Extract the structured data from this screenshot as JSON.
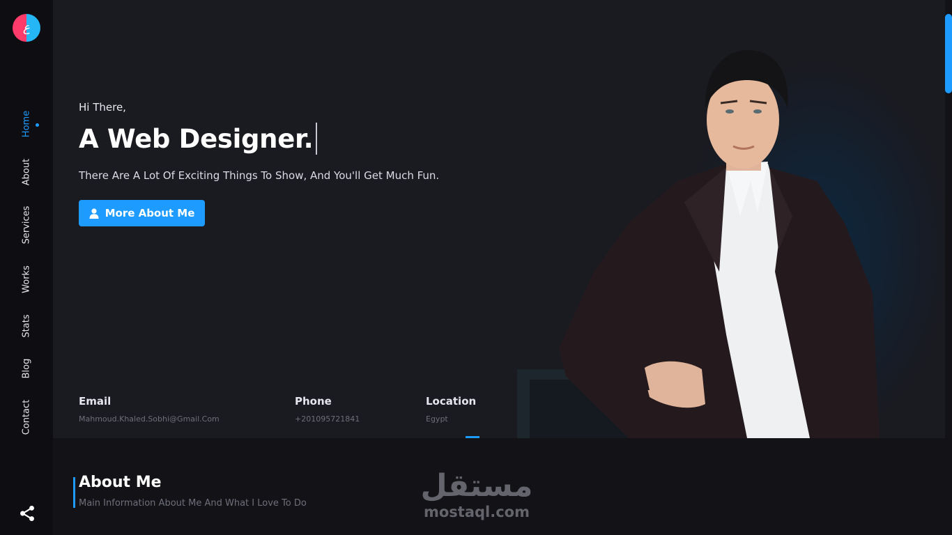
{
  "logo": {
    "glyph": "ع"
  },
  "nav": {
    "items": [
      {
        "label": "Home",
        "active": true
      },
      {
        "label": "About"
      },
      {
        "label": "Services"
      },
      {
        "label": "Works"
      },
      {
        "label": "Stats"
      },
      {
        "label": "Blog"
      },
      {
        "label": "Contact"
      }
    ]
  },
  "hero": {
    "greeting": "Hi There,",
    "headline": "A Web Designer.",
    "tagline": "There Are A Lot Of Exciting Things To Show, And You'll Get Much Fun.",
    "button_label": "More About Me"
  },
  "contact_info": {
    "email_label": "Email",
    "email_value": "Mahmoud.Khaled.Sobhi@Gmail.Com",
    "phone_label": "Phone",
    "phone_value": "+201095721841",
    "location_label": "Location",
    "location_value": "Egypt"
  },
  "about": {
    "title": "About Me",
    "subtitle": "Main Information About Me And What I Love To Do"
  },
  "watermark": {
    "arabic": "مستقل",
    "latin": "mostaql.com"
  },
  "colors": {
    "accent": "#1e9bff",
    "logo_left": "#ff3b6b",
    "logo_right": "#25b7f5",
    "background": "#1a1a21",
    "sidebar": "#0e0e12"
  },
  "icons": {
    "button_icon": "user-icon",
    "share_icon": "share-icon"
  }
}
